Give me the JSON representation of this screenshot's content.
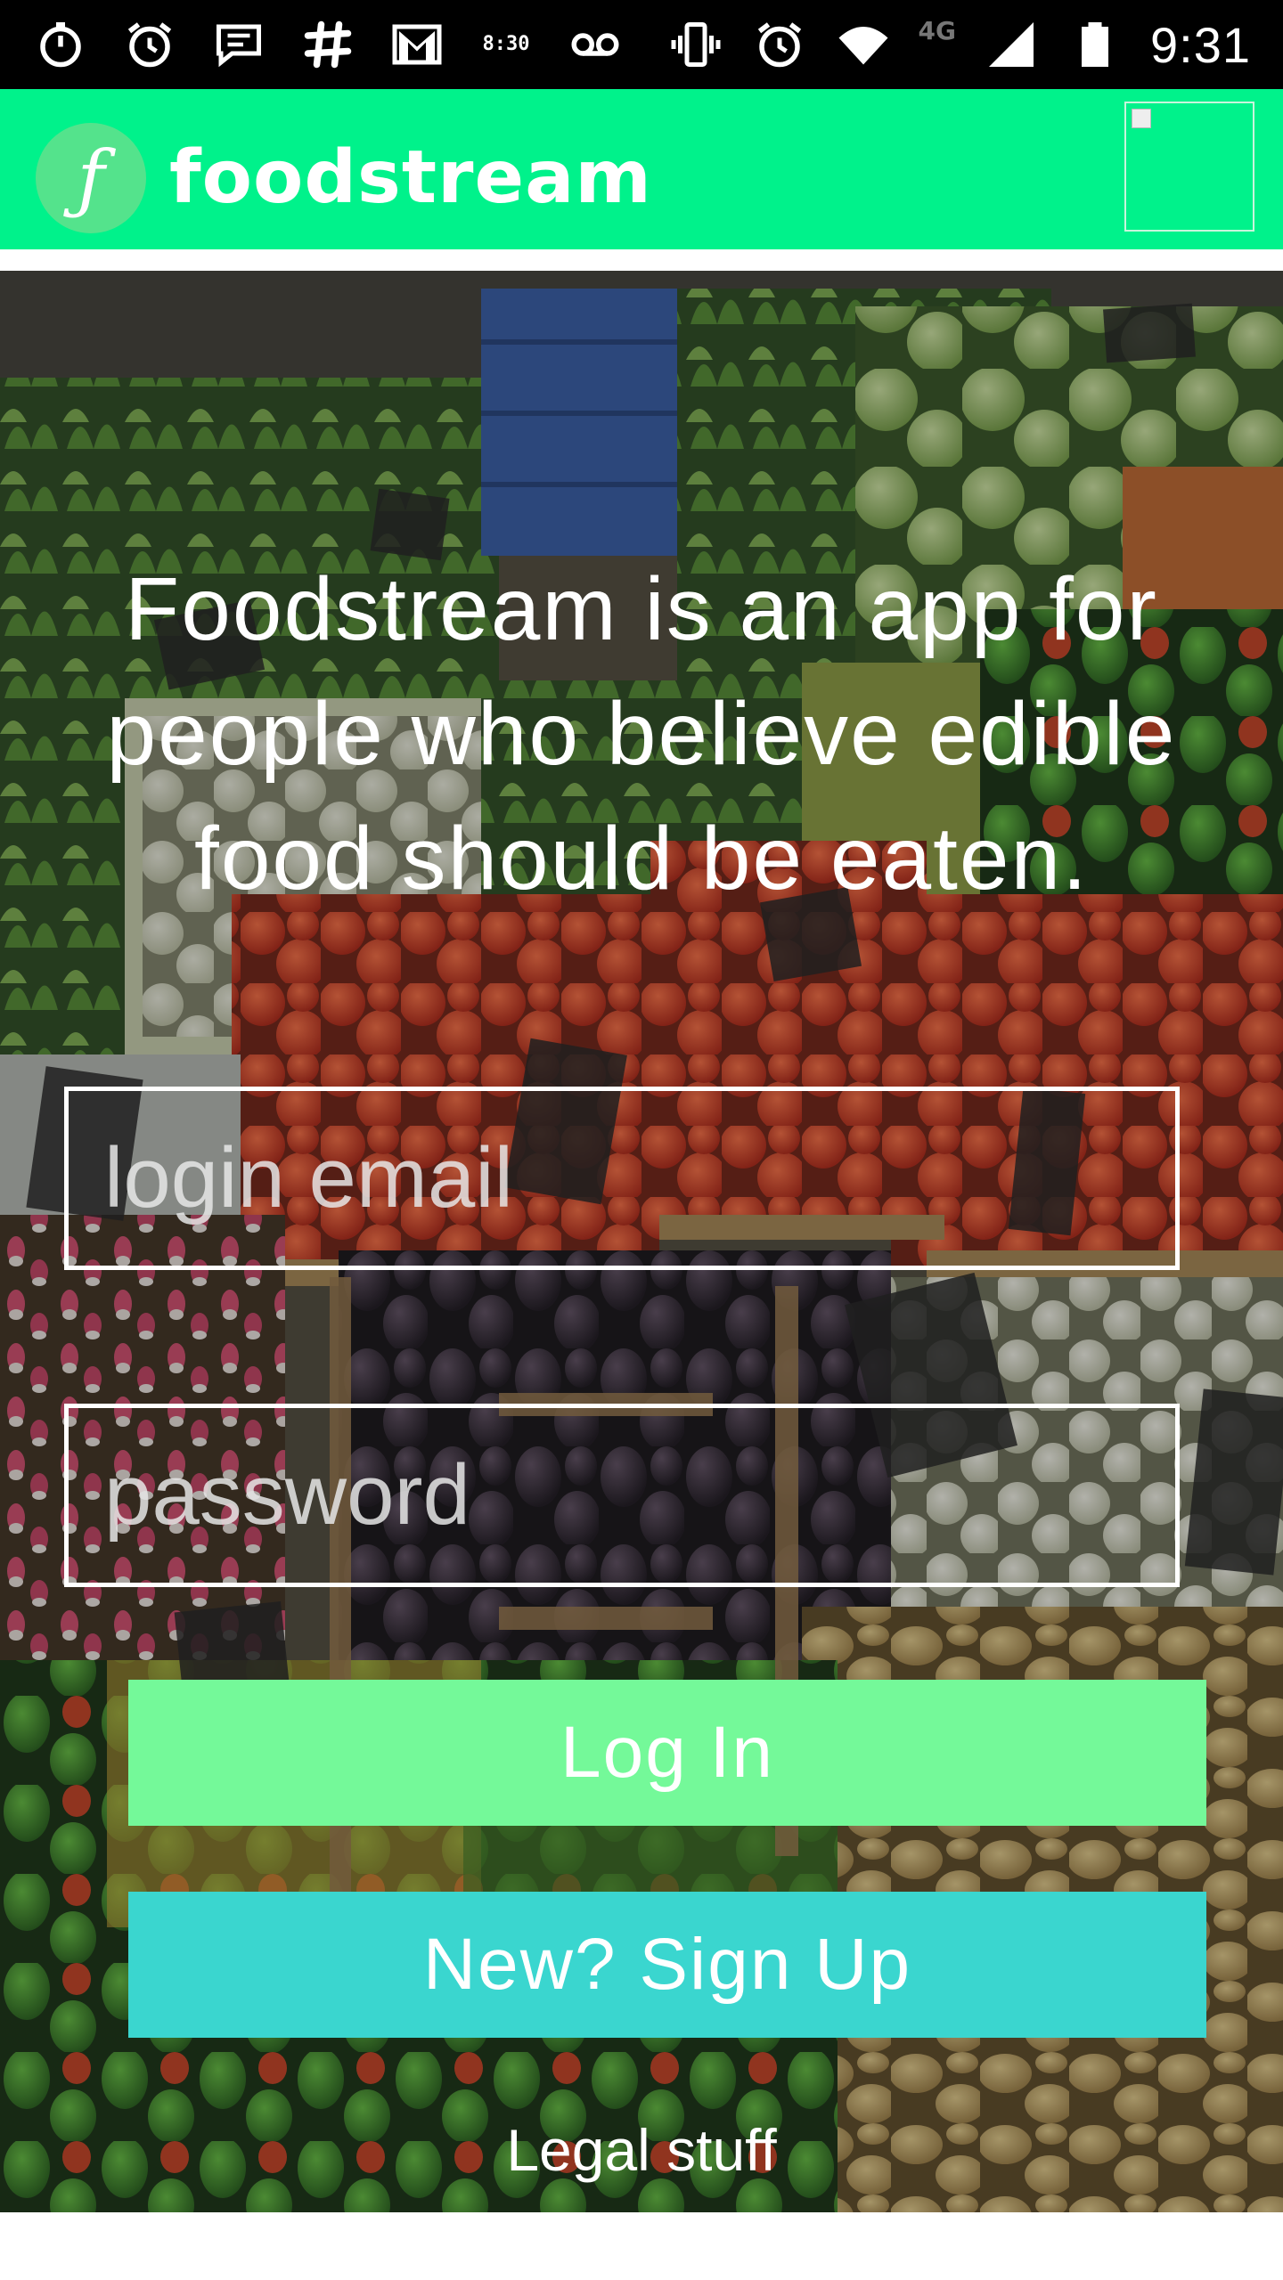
{
  "status_bar": {
    "time": "9:31",
    "network": "4G",
    "clock_widget_line1": "8:30",
    "left_icons": [
      "stopwatch-icon",
      "alarm-icon",
      "chat-icon",
      "slack-icon",
      "gmail-icon",
      "clock-widget-icon",
      "voicemail-icon"
    ],
    "right_icons": [
      "vibrate-icon",
      "alarm-icon",
      "wifi-icon",
      "cell-signal-icon",
      "battery-icon"
    ]
  },
  "app_bar": {
    "logo_glyph": "ƒ",
    "title": "foodstream",
    "color": "#00f28b"
  },
  "hero": {
    "tagline": "Foodstream is an app for people who believe edible food should be eaten."
  },
  "form": {
    "email_placeholder": "login email",
    "password_placeholder": "password",
    "login_label": "Log In",
    "signup_label": "New? Sign Up",
    "login_color": "#74f999",
    "signup_color": "#3ad6cf"
  },
  "footer": {
    "legal_label": "Legal stuff"
  }
}
